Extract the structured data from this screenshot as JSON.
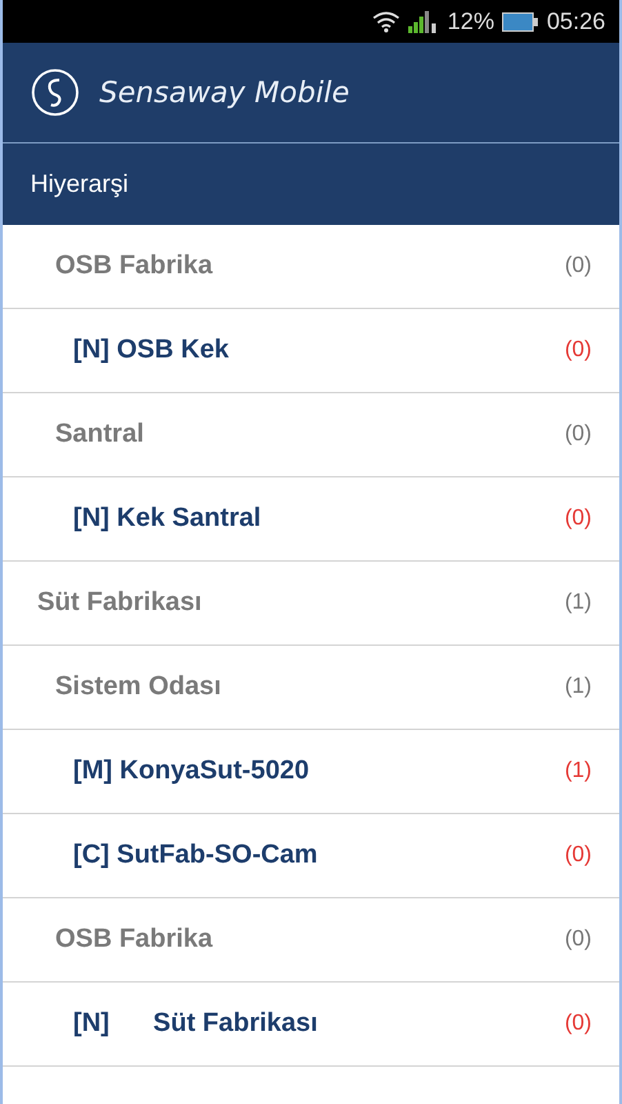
{
  "status_bar": {
    "battery_text": "12%",
    "time": "05:26"
  },
  "app_bar": {
    "title": "Sensaway Mobile"
  },
  "section": {
    "title": "Hiyerarşi"
  },
  "tree": [
    {
      "children": [
        {
          "kind": "group",
          "label": "OSB Fabrika",
          "count": "(0)",
          "children": [
            {
              "kind": "device",
              "label": "[N] OSB Kek",
              "count": "(0)"
            }
          ]
        },
        {
          "kind": "group",
          "label": "Santral",
          "count": "(0)",
          "children": [
            {
              "kind": "device",
              "label": "[N] Kek Santral",
              "count": "(0)"
            }
          ]
        }
      ]
    },
    {
      "kind": "group",
      "label": "Süt Fabrikası",
      "count": "(1)",
      "children": [
        {
          "kind": "group",
          "label": "Sistem Odası",
          "count": "(1)",
          "children": [
            {
              "kind": "device",
              "label": "[M] KonyaSut-5020",
              "count": "(1)"
            },
            {
              "kind": "device",
              "label": "[C] SutFab-SO-Cam",
              "count": "(0)"
            }
          ]
        },
        {
          "kind": "group",
          "label": "OSB Fabrika",
          "count": "(0)",
          "children": [
            {
              "kind": "device",
              "label": "[N]      Süt Fabrikası",
              "count": "(0)"
            }
          ]
        }
      ]
    }
  ]
}
